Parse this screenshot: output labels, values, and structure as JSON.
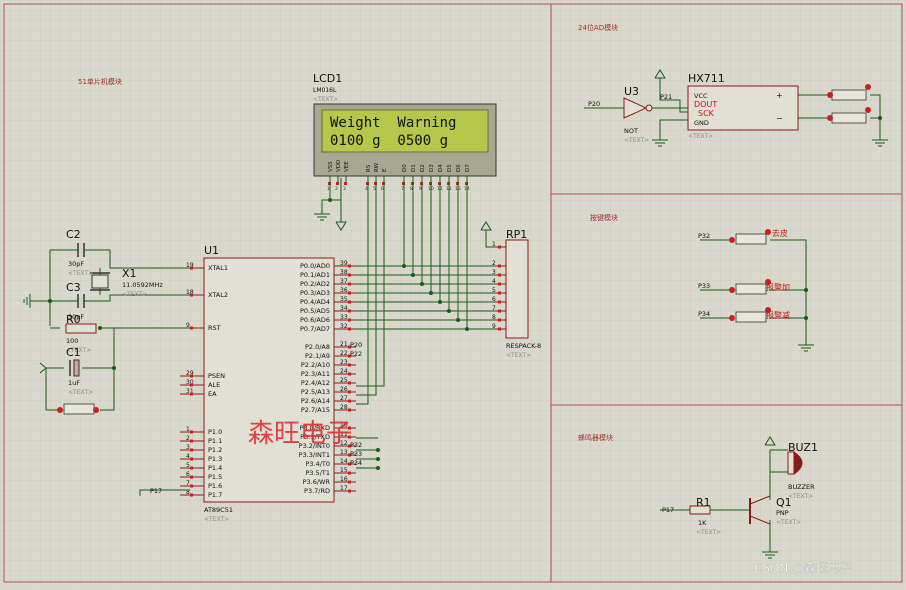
{
  "sections": {
    "mcu_module": "51单片机模块",
    "ad_module": "24位AD模块",
    "key_module": "按键模块",
    "buzzer_module": "蜂鸣器模块"
  },
  "lcd": {
    "ref": "LCD1",
    "part": "LM016L",
    "text_tag": "<TEXT>",
    "line1": "Weight  Warning",
    "line2": "0100 g  0500 g",
    "pins": [
      "VSS",
      "VDD",
      "VEE",
      "RS",
      "RW",
      "E",
      "D0",
      "D1",
      "D2",
      "D3",
      "D4",
      "D5",
      "D6",
      "D7"
    ],
    "pin_numbers": [
      "1",
      "2",
      "3",
      "4",
      "5",
      "6",
      "7",
      "8",
      "9",
      "10",
      "11",
      "12",
      "13",
      "14"
    ],
    "screen_color": "#b6c84a"
  },
  "mcu": {
    "ref": "U1",
    "part": "AT89C51",
    "text_tag": "<TEXT>",
    "left_pins": [
      {
        "num": "19",
        "name": "XTAL1"
      },
      {
        "num": "18",
        "name": "XTAL2"
      },
      {
        "num": "9",
        "name": "RST"
      },
      {
        "num": "29",
        "name": "PSEN"
      },
      {
        "num": "30",
        "name": "ALE"
      },
      {
        "num": "31",
        "name": "EA"
      },
      {
        "num": "1",
        "name": "P1.0"
      },
      {
        "num": "2",
        "name": "P1.1"
      },
      {
        "num": "3",
        "name": "P1.2"
      },
      {
        "num": "4",
        "name": "P1.3"
      },
      {
        "num": "5",
        "name": "P1.4"
      },
      {
        "num": "6",
        "name": "P1.5"
      },
      {
        "num": "7",
        "name": "P1.6"
      },
      {
        "num": "8",
        "name": "P1.7"
      }
    ],
    "right_pins": [
      {
        "num": "39",
        "name": "P0.0/AD0"
      },
      {
        "num": "38",
        "name": "P0.1/AD1"
      },
      {
        "num": "37",
        "name": "P0.2/AD2"
      },
      {
        "num": "36",
        "name": "P0.3/AD3"
      },
      {
        "num": "35",
        "name": "P0.4/AD4"
      },
      {
        "num": "34",
        "name": "P0.5/AD5"
      },
      {
        "num": "33",
        "name": "P0.6/AD6"
      },
      {
        "num": "32",
        "name": "P0.7/AD7"
      },
      {
        "num": "21",
        "name": "P2.0/A8"
      },
      {
        "num": "22",
        "name": "P2.1/A9"
      },
      {
        "num": "23",
        "name": "P2.2/A10"
      },
      {
        "num": "24",
        "name": "P2.3/A11"
      },
      {
        "num": "25",
        "name": "P2.4/A12"
      },
      {
        "num": "26",
        "name": "P2.5/A13"
      },
      {
        "num": "27",
        "name": "P2.6/A14"
      },
      {
        "num": "28",
        "name": "P2.7/A15"
      },
      {
        "num": "10",
        "name": "P3.0/RXD"
      },
      {
        "num": "11",
        "name": "P3.1/TXD"
      },
      {
        "num": "12",
        "name": "P3.2/INT0"
      },
      {
        "num": "13",
        "name": "P3.3/INT1"
      },
      {
        "num": "14",
        "name": "P3.4/T0"
      },
      {
        "num": "15",
        "name": "P3.5/T1"
      },
      {
        "num": "16",
        "name": "P3.6/WR"
      },
      {
        "num": "17",
        "name": "P3.7/RD"
      }
    ],
    "net_labels": [
      "P20",
      "P22",
      "P32",
      "P33",
      "P34",
      "P17"
    ]
  },
  "crystal": {
    "ref": "X1",
    "value": "11.0592MHz",
    "text_tag": "<TEXT>"
  },
  "c2": {
    "ref": "C2",
    "value": "30pF",
    "text_tag": "<TEXT>"
  },
  "c3": {
    "ref": "C3",
    "value": "30pF",
    "text_tag": "<TEXT>"
  },
  "c1": {
    "ref": "C1",
    "value": "1uF",
    "text_tag": "<TEXT>"
  },
  "r0": {
    "ref": "R0",
    "value": "100",
    "text_tag": "<TEXT>"
  },
  "rp1": {
    "ref": "RP1",
    "part": "RESPACK-8",
    "text_tag": "<TEXT>",
    "pins": [
      "1",
      "2",
      "3",
      "4",
      "5",
      "6",
      "7",
      "8",
      "9"
    ]
  },
  "u3": {
    "ref": "U3",
    "part": "NOT",
    "text_tag": "<TEXT>",
    "in_net": "P20",
    "out_net": "P21"
  },
  "hx711": {
    "ref": "HX711",
    "vcc": "VCC",
    "dout": "DOUT",
    "sck": "SCK",
    "gnd": "GND",
    "plus": "+",
    "minus": "−",
    "text_tag": "<TEXT>"
  },
  "keys": {
    "k1_net": "P32",
    "k1_label": "去皮",
    "k2_net": "P33",
    "k2_label": "报警加",
    "k3_net": "P34",
    "k3_label": "报警减"
  },
  "buzzer": {
    "ref": "BUZ1",
    "part": "BUZZER",
    "text_tag": "<TEXT>"
  },
  "r1": {
    "ref": "R1",
    "value": "1K",
    "text_tag": "<TEXT>"
  },
  "q1": {
    "ref": "Q1",
    "part": "PNP",
    "text_tag": "<TEXT>"
  },
  "p17_net": "P17",
  "watermark": "森旺电子",
  "credit": "CSDN @森旺电子",
  "colors": {
    "background": "#d8d8cc",
    "wire": "#1a5a1a",
    "component": "#8b1a1a",
    "border": "#b03030",
    "pin_red": "#cc2020",
    "pin_blue": "#2030d0",
    "watermark": "#e03030"
  }
}
